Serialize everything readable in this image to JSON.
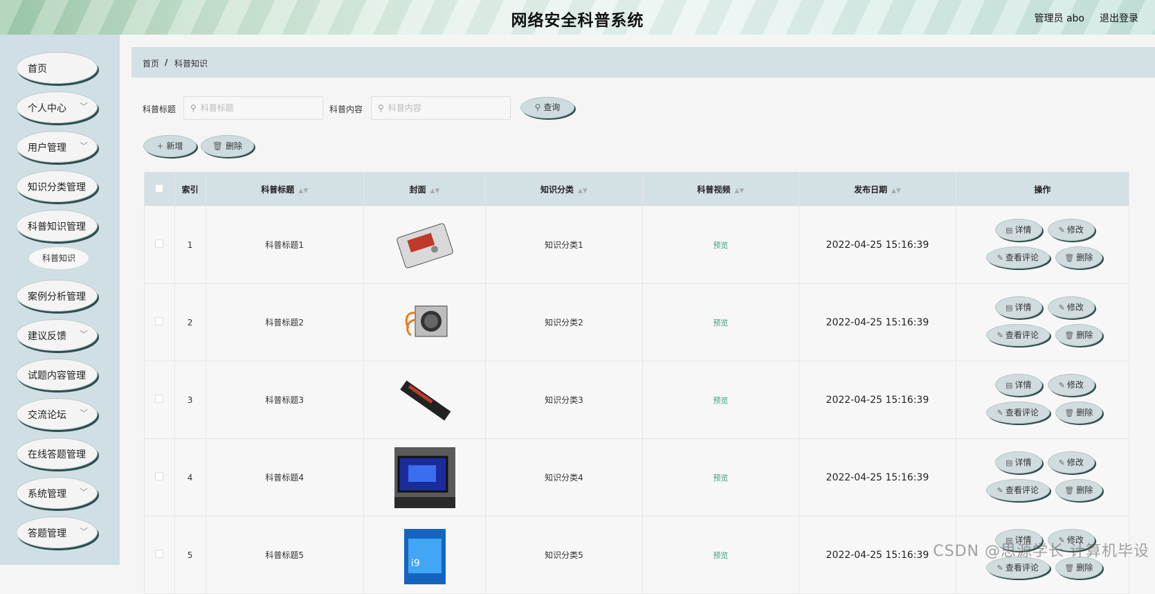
{
  "header": {
    "title": "网络安全科普系统",
    "user": "管理员 abo",
    "logout": "退出登录"
  },
  "sidebar": {
    "items": [
      {
        "label": "首页",
        "chevron": false
      },
      {
        "label": "个人中心",
        "chevron": true
      },
      {
        "label": "用户管理",
        "chevron": true
      },
      {
        "label": "知识分类管理",
        "chevron": false
      },
      {
        "label": "科普知识管理",
        "chevron": false
      },
      {
        "label": "案例分析管理",
        "chevron": false
      },
      {
        "label": "建议反馈",
        "chevron": true
      },
      {
        "label": "试题内容管理",
        "chevron": false
      },
      {
        "label": "交流论坛",
        "chevron": true
      },
      {
        "label": "在线答题管理",
        "chevron": false
      },
      {
        "label": "系统管理",
        "chevron": true
      },
      {
        "label": "答题管理",
        "chevron": true
      }
    ],
    "sub_item": "科普知识"
  },
  "breadcrumb": {
    "home": "首页",
    "separator": "/",
    "current": "科普知识"
  },
  "search": {
    "title_label": "科普标题",
    "title_placeholder": "科普标题",
    "content_label": "科普内容",
    "content_placeholder": "科普内容",
    "query_button": "查询"
  },
  "actions": {
    "add_button": "新增",
    "delete_button": "删除"
  },
  "table": {
    "columns": [
      "索引",
      "科普标题",
      "封面",
      "知识分类",
      "科普视频",
      "发布日期",
      "操作"
    ],
    "rows": [
      {
        "index": "1",
        "title": "科普标题1",
        "cover": "hard-drive",
        "category": "知识分类1",
        "video": "预览",
        "date": "2022-04-25 15:16:39"
      },
      {
        "index": "2",
        "title": "科普标题2",
        "cover": "power-supply",
        "category": "知识分类2",
        "video": "预览",
        "date": "2022-04-25 15:16:39"
      },
      {
        "index": "3",
        "title": "科普标题3",
        "cover": "memory-stick",
        "category": "知识分类3",
        "video": "预览",
        "date": "2022-04-25 15:16:39"
      },
      {
        "index": "4",
        "title": "科普标题4",
        "cover": "computer-monitor",
        "category": "知识分类4",
        "video": "预览",
        "date": "2022-04-25 15:16:39"
      },
      {
        "index": "5",
        "title": "科普标题5",
        "cover": "cpu-box",
        "category": "知识分类5",
        "video": "预览",
        "date": "2022-04-25 15:16:39"
      }
    ],
    "row_actions": {
      "detail": "详情",
      "edit": "修改",
      "comments": "查看评论",
      "delete": "删除"
    }
  },
  "watermark": "CSDN @思源学长 计算机毕设",
  "colors": {
    "sidebar_bg": "#cfdfe3",
    "header_band": "#d3e0e4",
    "preview_link": "#3aa17e",
    "button_shadow": "#2f4f4f"
  }
}
